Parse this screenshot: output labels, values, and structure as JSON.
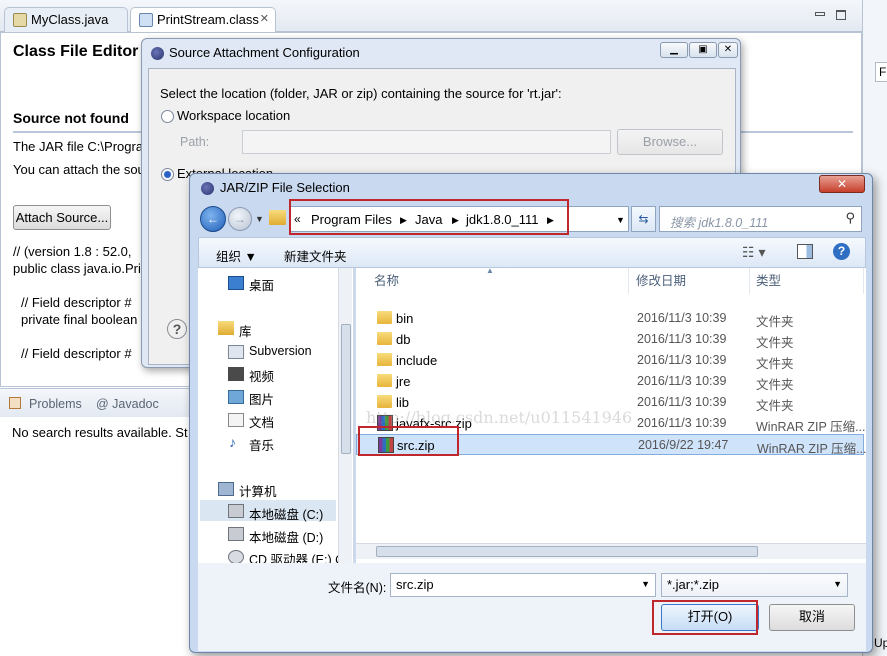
{
  "eclipse": {
    "tabs": [
      {
        "label": "MyClass.java"
      },
      {
        "label": "PrintStream.class"
      }
    ],
    "editor_title": "Class File Editor",
    "source_not_found": "Source not found",
    "line1": "The JAR file C:\\Progra",
    "line2": "You can attach the sou",
    "attach_button": "Attach Source...",
    "code1": "//  (version 1.8 : 52.0,",
    "code2": "public class java.io.Pri",
    "code3": "// Field descriptor #",
    "code4": "private final boolean",
    "code5": "// Field descriptor #",
    "bottom_tabs": [
      "Problems",
      "@ Javadoc"
    ],
    "bottom_msg": "No search results available. St",
    "right_edge_label": "Up",
    "right_edge_input": "F"
  },
  "source_dialog": {
    "title": "Source Attachment Configuration",
    "prompt": "Select the location (folder, JAR or zip) containing the source for 'rt.jar':",
    "workspace_label": "Workspace location",
    "path_label": "Path:",
    "browse_label": "Browse...",
    "external_label": "External location",
    "help_glyph": "?"
  },
  "zip_dialog": {
    "title": "JAR/ZIP File Selection",
    "close_glyph": "✕",
    "breadcrumb": [
      "Program Files",
      "Java",
      "jdk1.8.0_111"
    ],
    "search_placeholder": "搜索 jdk1.8.0_111",
    "organize_label": "组织 ▼",
    "new_folder_label": "新建文件夹",
    "nav": {
      "desktop": "桌面",
      "library": "库",
      "subversion": "Subversion",
      "video": "视频",
      "pictures": "图片",
      "documents": "文档",
      "music": "音乐",
      "computer": "计算机",
      "disk_c": "本地磁盘 (C:)",
      "disk_d": "本地磁盘 (D:)",
      "cd_drive": "CD 驱动器 (E:) C"
    },
    "columns": {
      "name": "名称",
      "date": "修改日期",
      "type": "类型"
    },
    "files": [
      {
        "name": "bin",
        "date": "2016/11/3 10:39",
        "type": "文件夹",
        "kind": "folder"
      },
      {
        "name": "db",
        "date": "2016/11/3 10:39",
        "type": "文件夹",
        "kind": "folder"
      },
      {
        "name": "include",
        "date": "2016/11/3 10:39",
        "type": "文件夹",
        "kind": "folder"
      },
      {
        "name": "jre",
        "date": "2016/11/3 10:39",
        "type": "文件夹",
        "kind": "folder"
      },
      {
        "name": "lib",
        "date": "2016/11/3 10:39",
        "type": "文件夹",
        "kind": "folder"
      },
      {
        "name": "javafx-src.zip",
        "date": "2016/11/3 10:39",
        "type": "WinRAR ZIP 压缩...",
        "kind": "zip"
      },
      {
        "name": "src.zip",
        "date": "2016/9/22 19:47",
        "type": "WinRAR ZIP 压缩...",
        "kind": "zip",
        "selected": true
      }
    ],
    "filename_label": "文件名(N):",
    "filename_value": "src.zip",
    "filter_value": "*.jar;*.zip",
    "open_label": "打开(O)",
    "cancel_label": "取消",
    "watermark": "http://blog.csdn.net/u011541946"
  }
}
